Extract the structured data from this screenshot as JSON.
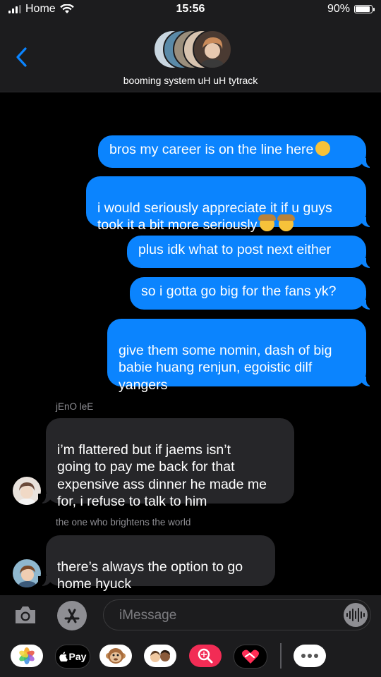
{
  "status_bar": {
    "carrier": "Home",
    "time": "15:56",
    "battery": "90%",
    "battery_level": 0.9
  },
  "header": {
    "group_name": "booming system uH uH tytrack"
  },
  "messages": [
    {
      "text": "bros my career is on the line here"
    },
    {
      "text": "i would seriously appreciate it if u guys\ntook it a bit more seriously"
    },
    {
      "text": "plus idk what to post next either"
    },
    {
      "text": "so i gotta go big for the fans yk?"
    },
    {
      "text": "give them some nomin, dash of big\nbabie huang renjun, egoistic dilf\nyangers"
    },
    {
      "sender": "jEnO leE",
      "text": "i’m flattered but if jaems isn’t\ngoing to pay me back for that\nexpensive ass dinner he made me\nfor, i refuse to talk to him"
    },
    {
      "sender": "the one who brightens the world",
      "text": "there’s always the option to go\nhome hyuck"
    }
  ],
  "input": {
    "placeholder": "iMessage"
  },
  "app_drawer": {
    "apple_pay_label": "Pay"
  },
  "colors": {
    "sent_bubble": "#0b84fe",
    "received_bubble": "#262629",
    "bar_bg": "#1c1c1e",
    "accent": "#0a84ff"
  }
}
